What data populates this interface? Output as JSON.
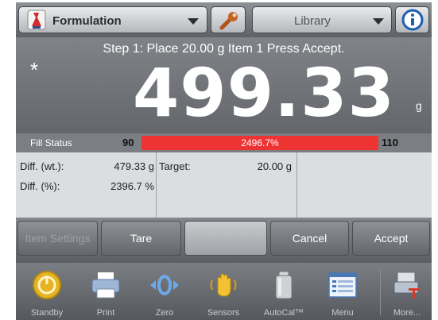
{
  "header": {
    "app_mode": "Formulation",
    "library_label": "Library"
  },
  "display": {
    "prompt": "Step 1: Place 20.00 g Item 1 Press Accept.",
    "stable_marker": "*",
    "weight": "499.33",
    "unit": "g"
  },
  "fill_status": {
    "label": "Fill Status",
    "min": "90",
    "max": "110",
    "percent_text": "2496.7%",
    "fill_fraction": 1.0
  },
  "data_panel": {
    "diff_wt_label": "Diff. (wt.):",
    "diff_wt_value": "479.33 g",
    "diff_pct_label": "Diff. (%):",
    "diff_pct_value": "2396.7 %",
    "target_label": "Target:",
    "target_value": "20.00 g"
  },
  "soft_buttons": {
    "item_settings": "Item Settings",
    "tare": "Tare",
    "cancel": "Cancel",
    "accept": "Accept"
  },
  "nav": {
    "standby": "Standby",
    "print": "Print",
    "zero": "Zero",
    "sensors": "Sensors",
    "autocal": "AutoCal™",
    "menu": "Menu",
    "more": "More..."
  },
  "colors": {
    "fill_bar": "#ee3333",
    "background": "#6a6d72"
  }
}
